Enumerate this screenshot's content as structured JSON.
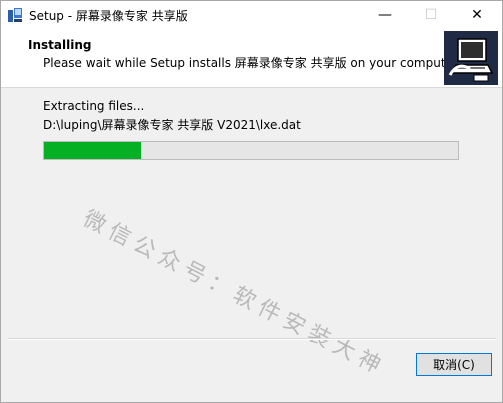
{
  "window": {
    "title": "Setup - 屏幕录像专家 共享版",
    "min_glyph": "—",
    "max_glyph": "☐",
    "close_glyph": "✕"
  },
  "header": {
    "title": "Installing",
    "subtitle": "Please wait while Setup installs 屏幕录像专家 共享版 on your computer."
  },
  "content": {
    "status": "Extracting files...",
    "file_path": "D:\\luping\\屏幕录像专家 共享版 V2021\\lxe.dat",
    "progress": 0.235,
    "progress_color": "#06b025"
  },
  "watermark": "微信公众号：软件安装大神",
  "footer": {
    "cancel_label": "取消(C)"
  }
}
